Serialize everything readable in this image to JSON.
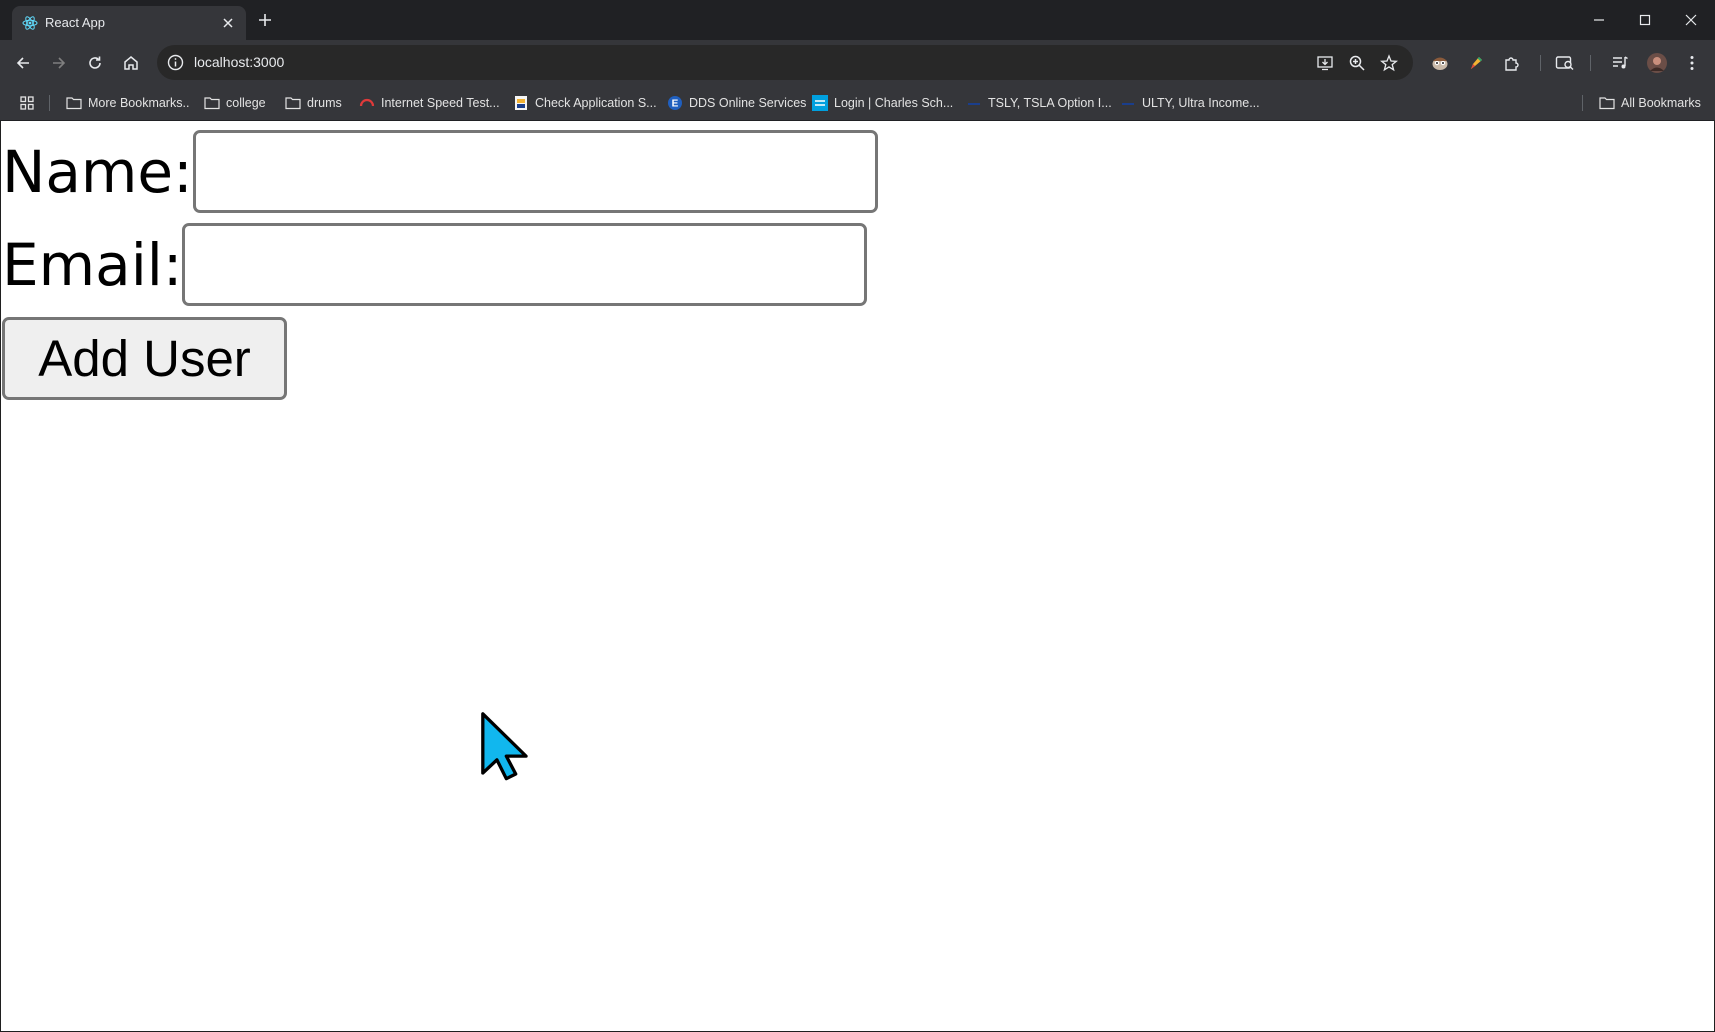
{
  "browser": {
    "tab": {
      "title": "React App"
    },
    "address_bar": {
      "url": "localhost:3000"
    },
    "bookmarks": [
      {
        "label": "More Bookmarks..",
        "icon": "folder-icon"
      },
      {
        "label": "college",
        "icon": "folder-icon"
      },
      {
        "label": "drums",
        "icon": "folder-icon"
      },
      {
        "label": "Internet Speed Test...",
        "icon": "speedtest-icon"
      },
      {
        "label": "Check Application S...",
        "icon": "site-icon"
      },
      {
        "label": "DDS Online Services",
        "icon": "dds-icon"
      },
      {
        "label": "Login | Charles Sch...",
        "icon": "schwab-icon"
      },
      {
        "label": "TSLY, TSLA Option I...",
        "icon": "site-icon"
      },
      {
        "label": "ULTY, Ultra Income...",
        "icon": "site-icon"
      }
    ],
    "all_bookmarks_label": "All Bookmarks"
  },
  "form": {
    "name_label": "Name:",
    "name_value": "",
    "email_label": "Email:",
    "email_value": "",
    "submit_label": "Add User"
  },
  "colors": {
    "chrome_dark": "#202124",
    "toolbar": "#35363a",
    "cursor_fill": "#11b7ee"
  }
}
